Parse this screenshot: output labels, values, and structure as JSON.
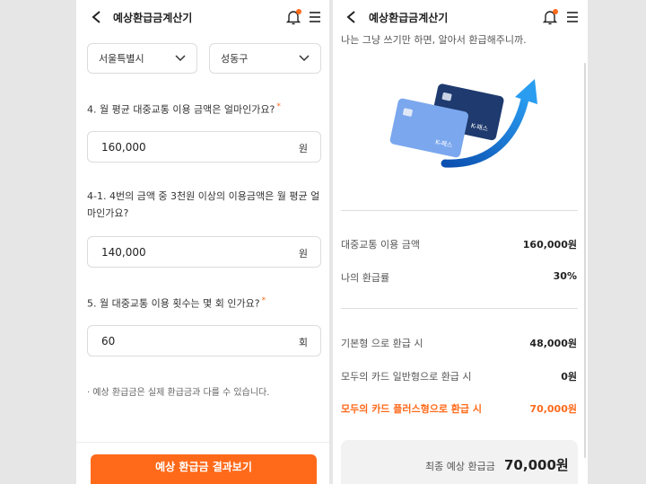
{
  "colors": {
    "accent": "#ff6a1a",
    "border": "#dcdcdc",
    "background": "#e6e6e6"
  },
  "header": {
    "title": "예상환급금계산기",
    "icons": [
      "back-arrow-icon",
      "bell-icon",
      "hamburger-menu-icon"
    ]
  },
  "left": {
    "region": {
      "city": "서울특별시",
      "district": "성동구"
    },
    "q4": {
      "label": "4. 월 평균 대중교통 이용 금액은 얼마인가요?",
      "required_mark": "*",
      "value": "160,000",
      "unit": "원"
    },
    "q4_1": {
      "label_line1": "4-1. 4번의 금액 중 3천원 이상의 이용금액은 월 평균 얼",
      "label_line2": "마인가요?",
      "value": "140,000",
      "unit": "원"
    },
    "q5": {
      "label": "5. 월 대중교통 이용 횟수는 몇 회 인가요?",
      "required_mark": "*",
      "value": "60",
      "unit": "회"
    },
    "note": "· 예상 환급금은 실제 환급금과 다를 수 있습니다.",
    "cta_label": "예상 환급금 결과보기"
  },
  "right": {
    "intro": "나는 그냥 쓰기만 하면, 알아서 환급해주니까.",
    "card_text_front": "K-패스",
    "card_text_back": "K-패스",
    "rows": [
      {
        "label": "대중교통 이용 금액",
        "value": "160,000원"
      },
      {
        "label": "나의 환급률",
        "value": "30%"
      },
      {
        "label": "기본형 으로 환급 시",
        "value": "48,000원"
      },
      {
        "label": "모두의 카드 일반형으로 환급 시",
        "value": "0원"
      },
      {
        "label": "모두의 카드 플러스형으로 환급 시",
        "value": "70,000원"
      }
    ],
    "total": {
      "label": "최종 예상 환급금",
      "value": "70,000원"
    }
  }
}
